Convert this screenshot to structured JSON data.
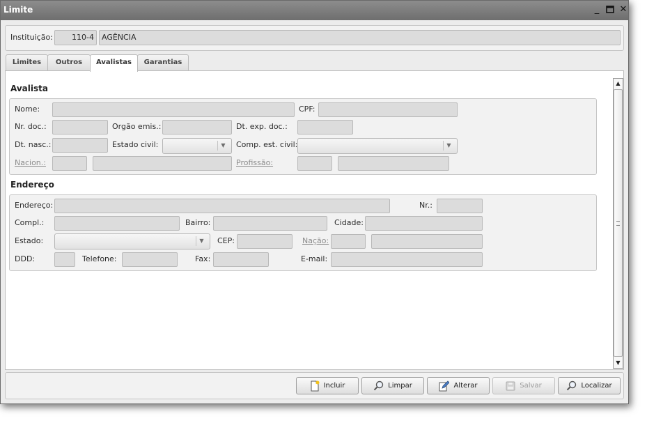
{
  "window": {
    "title": "Limite"
  },
  "header": {
    "instituicao_label": "Instituição:",
    "instituicao_code": "110-4",
    "instituicao_name": "AGÊNCIA"
  },
  "tabs": [
    {
      "label": "Limites",
      "active": false
    },
    {
      "label": "Outros",
      "active": false
    },
    {
      "label": "Avalistas",
      "active": true
    },
    {
      "label": "Garantias",
      "active": false
    }
  ],
  "avalista": {
    "section_title": "Avalista",
    "nome_label": "Nome:",
    "nome_value": "",
    "cpf_label": "CPF:",
    "cpf_value": "",
    "nr_doc_label": "Nr. doc.:",
    "nr_doc_value": "",
    "orgao_emis_label": "Orgão emis.:",
    "orgao_emis_value": "",
    "dt_exp_doc_label": "Dt. exp. doc.:",
    "dt_exp_doc_value": "",
    "dt_nasc_label": "Dt. nasc.:",
    "dt_nasc_value": "",
    "estado_civil_label": "Estado civil:",
    "estado_civil_value": "",
    "comp_est_civil_label": "Comp. est. civil:",
    "comp_est_civil_value": "",
    "nacion_label": "Nacion.:",
    "nacion_code": "",
    "nacion_name": "",
    "profissao_label": "Profissão:",
    "profissao_code": "",
    "profissao_name": ""
  },
  "endereco": {
    "section_title": "Endereço",
    "endereco_label": "Endereço:",
    "endereco_value": "",
    "nr_label": "Nr.:",
    "nr_value": "",
    "compl_label": "Compl.:",
    "compl_value": "",
    "bairro_label": "Bairro:",
    "bairro_value": "",
    "cidade_label": "Cidade:",
    "cidade_value": "",
    "estado_label": "Estado:",
    "estado_value": "",
    "cep_label": "CEP:",
    "cep_value": "",
    "nacao_label": "Nação:",
    "nacao_code": "",
    "nacao_name": "",
    "ddd_label": "DDD:",
    "ddd_value": "",
    "telefone_label": "Telefone:",
    "telefone_value": "",
    "fax_label": "Fax:",
    "fax_value": "",
    "email_label": "E-mail:",
    "email_value": ""
  },
  "toolbar": {
    "incluir_label": "Incluir",
    "limpar_label": "Limpar",
    "alterar_label": "Alterar",
    "salvar_label": "Salvar",
    "localizar_label": "Localizar"
  },
  "colors": {
    "title_bar": "#7b7b7b",
    "field_bg": "#dcdcdc",
    "link": "#8c8c8c",
    "disabled_text": "#9a9a9a"
  },
  "icons": {
    "minimize": "minimize-icon",
    "maximize": "maximize-icon",
    "close": "close-icon",
    "incluir": "new-document-icon",
    "limpar": "magnifier-icon",
    "alterar": "edit-pencil-icon",
    "salvar": "save-disk-icon",
    "localizar": "magnifier-icon"
  }
}
